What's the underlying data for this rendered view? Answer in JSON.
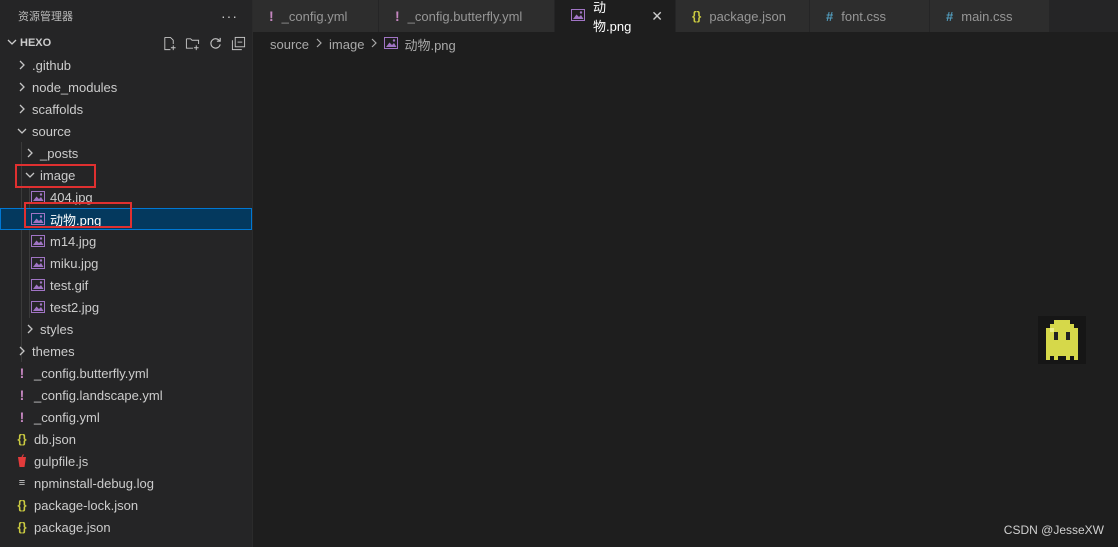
{
  "sidebar": {
    "title": "资源管理器",
    "more": "···",
    "project": "HEXO",
    "items": [
      {
        "label": ".github",
        "kind": "folder",
        "expanded": false
      },
      {
        "label": "node_modules",
        "kind": "folder",
        "expanded": false
      },
      {
        "label": "scaffolds",
        "kind": "folder",
        "expanded": false
      },
      {
        "label": "source",
        "kind": "folder",
        "expanded": true
      },
      {
        "label": "_posts",
        "kind": "folder",
        "expanded": false
      },
      {
        "label": "image",
        "kind": "folder",
        "expanded": true
      },
      {
        "label": "404.jpg",
        "kind": "image"
      },
      {
        "label": "动物.png",
        "kind": "image",
        "selected": true
      },
      {
        "label": "m14.jpg",
        "kind": "image"
      },
      {
        "label": "miku.jpg",
        "kind": "image"
      },
      {
        "label": "test.gif",
        "kind": "image"
      },
      {
        "label": "test2.jpg",
        "kind": "image"
      },
      {
        "label": "styles",
        "kind": "folder",
        "expanded": false
      },
      {
        "label": "themes",
        "kind": "folder",
        "expanded": false
      },
      {
        "label": "_config.butterfly.yml",
        "kind": "yaml"
      },
      {
        "label": "_config.landscape.yml",
        "kind": "yaml"
      },
      {
        "label": "_config.yml",
        "kind": "yaml"
      },
      {
        "label": "db.json",
        "kind": "json"
      },
      {
        "label": "gulpfile.js",
        "kind": "gulp"
      },
      {
        "label": "npminstall-debug.log",
        "kind": "log"
      },
      {
        "label": "package-lock.json",
        "kind": "json"
      },
      {
        "label": "package.json",
        "kind": "json"
      }
    ]
  },
  "tabs": [
    {
      "label": "_config.yml",
      "icon": "yaml-icon"
    },
    {
      "label": "_config.butterfly.yml",
      "icon": "yaml-icon"
    },
    {
      "label": "动物.png",
      "icon": "image-icon",
      "active": true,
      "close": "✕"
    },
    {
      "label": "package.json",
      "icon": "json-icon"
    },
    {
      "label": "font.css",
      "icon": "css-icon"
    },
    {
      "label": "main.css",
      "icon": "css-icon"
    }
  ],
  "breadcrumb": [
    "source",
    "image",
    "动物.png"
  ],
  "watermark": "CSDN @JesseXW",
  "colors": {
    "accent": "#0078d4",
    "selection": "#04395e",
    "highlight_box": "#e03030",
    "yaml": "#c586c0",
    "json": "#cbcb41",
    "css": "#519aba"
  }
}
